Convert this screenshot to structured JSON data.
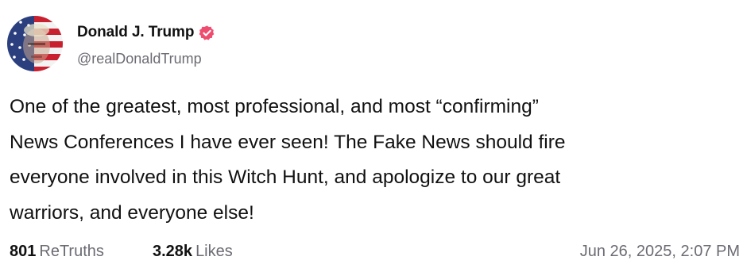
{
  "author": {
    "display_name": "Donald J. Trump",
    "handle": "@realDonaldTrump",
    "verified": true,
    "avatar_icon": "avatar-portrait-flag",
    "verified_icon": "verified-badge-icon",
    "badge_color": "#ef4d6f"
  },
  "post": {
    "lines": [
      "One of the greatest, most professional, and most “confirming”",
      "News Conferences I have ever seen! The Fake News should fire",
      "everyone involved in this Witch Hunt, and apologize to our great",
      "warriors, and everyone else!"
    ]
  },
  "stats": {
    "retruths_count": "801",
    "retruths_label": "ReTruths",
    "likes_count": "3.28k",
    "likes_label": "Likes"
  },
  "timestamp": "Jun 26, 2025, 2:07 PM"
}
